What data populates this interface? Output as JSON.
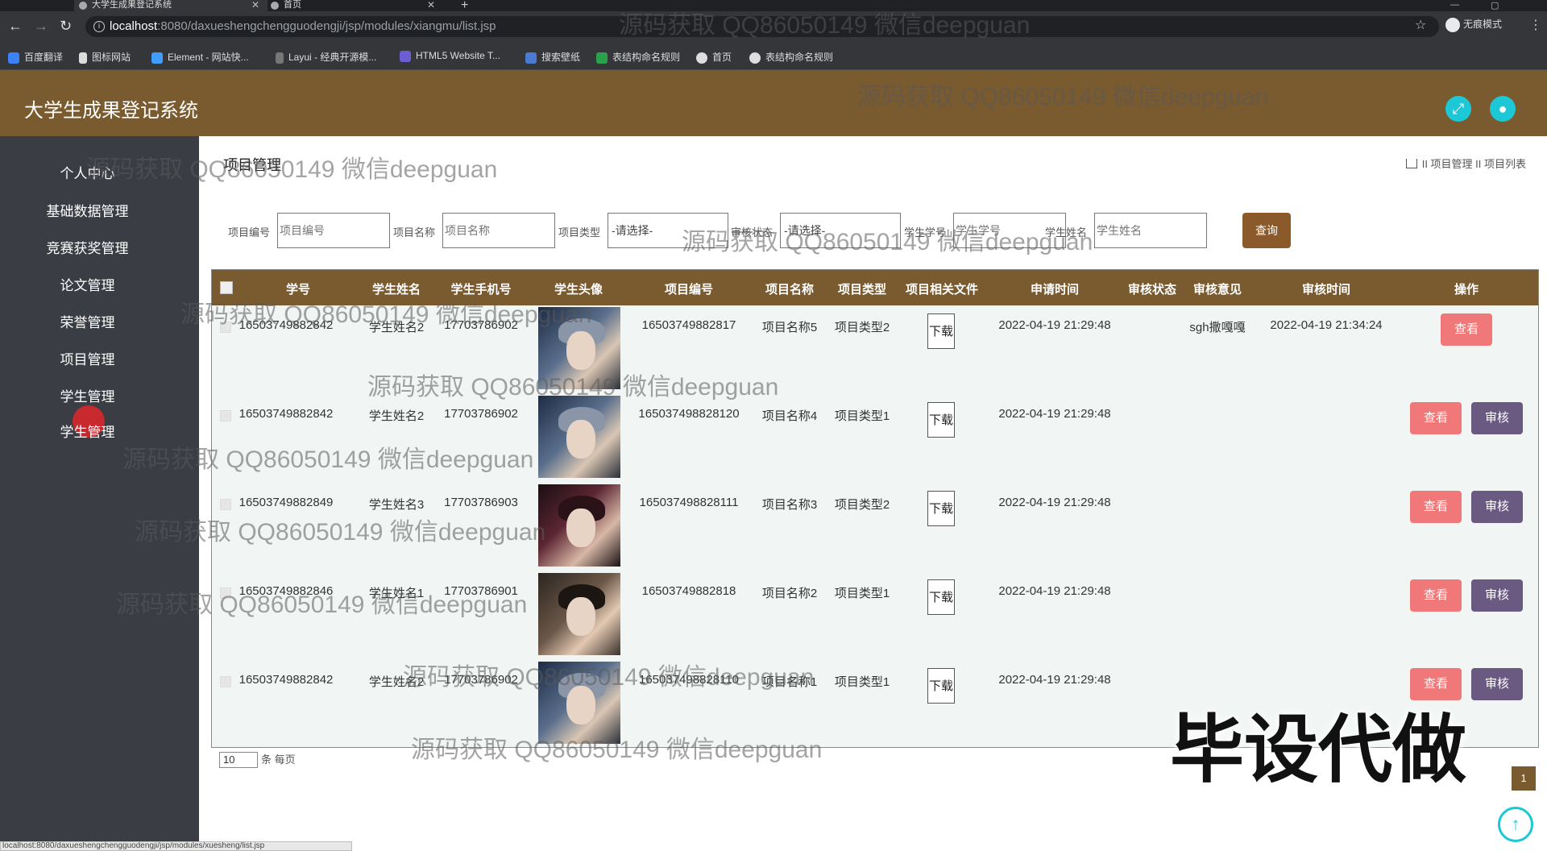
{
  "browser": {
    "tabs": [
      {
        "label": "大学生成果登记系统"
      },
      {
        "label": "首页"
      }
    ],
    "url_host": "localhost",
    "url_rest": ":8080/daxueshengchengguodengji/jsp/modules/xiangmu/list.jsp",
    "profile_label": "无痕模式",
    "bookmarks": [
      "百度翻译",
      "图标网站",
      "Element - 网站快...",
      "Layui - 经典开源模...",
      "HTML5 Website T...",
      "搜索壁纸",
      "表结构命名规则",
      "首页",
      "表结构命名规则"
    ],
    "status_url": "localhost:8080/daxueshengchengguodengji/jsp/modules/xuesheng/list.jsp"
  },
  "app": {
    "title": "大学生成果登记系统"
  },
  "sidebar": {
    "items": [
      "个人中心",
      "基础数据管理",
      "竞赛获奖管理",
      "论文管理",
      "荣誉管理",
      "项目管理",
      "学生管理",
      "学生管理"
    ]
  },
  "page": {
    "heading": "项目管理",
    "breadcrumb": "II 项目管理 II 项目列表"
  },
  "search": {
    "fields": [
      {
        "label": "项目编号",
        "placeholder": "项目编号"
      },
      {
        "label": "项目名称",
        "placeholder": "项目名称"
      },
      {
        "label": "项目类型",
        "value": "-请选择-"
      },
      {
        "label": "审核状态",
        "value": "-请选择-"
      },
      {
        "label": "学生学号",
        "placeholder": "学生学号"
      },
      {
        "label": "学生姓名",
        "placeholder": "学生姓名"
      }
    ],
    "button": "查询"
  },
  "table": {
    "headers": [
      "学号",
      "学生姓名",
      "学生手机号",
      "学生头像",
      "项目编号",
      "项目名称",
      "项目类型",
      "项目相关文件",
      "申请时间",
      "审核状态",
      "审核意见",
      "审核时间",
      "操作"
    ],
    "download_label": "下载",
    "view_label": "查看",
    "audit_label": "审核",
    "rows": [
      {
        "xuehao": "16503749882842",
        "name": "学生姓名2",
        "phone": "17703786902",
        "code": "16503749882817",
        "pname": "项目名称5",
        "ptype": "项目类型2",
        "apply_time": "2022-04-19 21:29:48",
        "status": "",
        "opinion": "sgh撒嘎嘎",
        "audit_time": "2022-04-19 21:34:24",
        "can_audit": false
      },
      {
        "xuehao": "16503749882842",
        "name": "学生姓名2",
        "phone": "17703786902",
        "code": "165037498828120",
        "pname": "项目名称4",
        "ptype": "项目类型1",
        "apply_time": "2022-04-19 21:29:48",
        "status": "",
        "opinion": "",
        "audit_time": "",
        "can_audit": true
      },
      {
        "xuehao": "16503749882849",
        "name": "学生姓名3",
        "phone": "17703786903",
        "code": "165037498828111",
        "pname": "项目名称3",
        "ptype": "项目类型2",
        "apply_time": "2022-04-19 21:29:48",
        "status": "",
        "opinion": "",
        "audit_time": "",
        "can_audit": true
      },
      {
        "xuehao": "16503749882846",
        "name": "学生姓名1",
        "phone": "17703786901",
        "code": "16503749882818",
        "pname": "项目名称2",
        "ptype": "项目类型1",
        "apply_time": "2022-04-19 21:29:48",
        "status": "",
        "opinion": "",
        "audit_time": "",
        "can_audit": true
      },
      {
        "xuehao": "16503749882842",
        "name": "学生姓名2",
        "phone": "17703786902",
        "code": "165037498828110",
        "pname": "项目名称1",
        "ptype": "项目类型1",
        "apply_time": "2022-04-19 21:29:48",
        "status": "",
        "opinion": "",
        "audit_time": "",
        "can_audit": true
      }
    ]
  },
  "pager": {
    "page_size": "10",
    "page_size_suffix": "条 每页",
    "current_page": "1"
  },
  "overlay": {
    "watermark": "源码获取 QQ86050149 微信deepguan",
    "big_text": "毕设代做"
  },
  "colors": {
    "header_brown": "#7a5a2f",
    "sidebar_dark": "#3a3d43",
    "accent_cyan": "#1cc8d6",
    "view_pink": "#f07878",
    "audit_purple": "#6a5a82"
  }
}
